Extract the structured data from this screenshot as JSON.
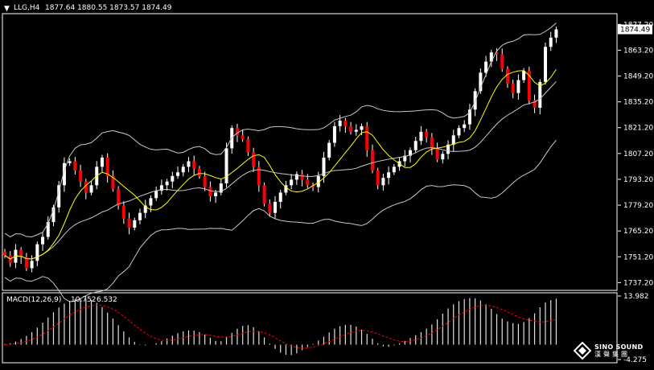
{
  "header": {
    "symbol_timeframe": "LLG,H4",
    "ohlc_values": "1877.64 1880.55 1873.57 1874.49"
  },
  "watermark": {
    "title": "SINO SOUND",
    "subtitle": "漢聲集團"
  },
  "chart_data": [
    {
      "type": "candlestick",
      "title": "LLG,H4",
      "ylim": [
        1733,
        1883
      ],
      "yticks": [
        "1877.20",
        "1863.20",
        "1849.20",
        "1835.20",
        "1821.20",
        "1807.20",
        "1793.20",
        "1779.20",
        "1765.20",
        "1751.20",
        "1737.20"
      ],
      "current_price": "1874.49",
      "colors": {
        "up": "#ffffff",
        "down": "#ff0000",
        "wick": "#ffffff",
        "ma": "#ffff00",
        "bands": "#c8c8c8",
        "axis": "#ffffff"
      },
      "overlays": [
        "moving average (yellow)",
        "Bollinger bands (grey)"
      ],
      "close": [
        1752,
        1748,
        1755,
        1751,
        1745,
        1749,
        1758,
        1762,
        1770,
        1778,
        1790,
        1802,
        1803,
        1798,
        1792,
        1786,
        1790,
        1800,
        1805,
        1795,
        1788,
        1779,
        1772,
        1767,
        1771,
        1775,
        1779,
        1783,
        1787,
        1790,
        1792,
        1795,
        1797,
        1800,
        1803,
        1799,
        1795,
        1789,
        1784,
        1786,
        1791,
        1810,
        1821,
        1817,
        1815,
        1808,
        1800,
        1790,
        1780,
        1775,
        1781,
        1786,
        1790,
        1793,
        1796,
        1793,
        1790,
        1789,
        1795,
        1805,
        1813,
        1822,
        1825,
        1822,
        1819,
        1820,
        1822,
        1809,
        1798,
        1790,
        1794,
        1797,
        1800,
        1803,
        1806,
        1809,
        1814,
        1819,
        1816,
        1810,
        1804,
        1807,
        1812,
        1817,
        1821,
        1823,
        1831,
        1841,
        1851,
        1857,
        1862,
        1861,
        1853,
        1845,
        1840,
        1847,
        1852,
        1836,
        1832,
        1846,
        1865,
        1870,
        1874.49
      ]
    },
    {
      "type": "bar",
      "title": "MACD(12,26,9)",
      "main_value": "10.752",
      "signal_value": "6.532",
      "ylim": [
        -4.275,
        13.982
      ],
      "yticks": [
        "13.982",
        "-4.275"
      ],
      "colors": {
        "histogram": "#e0e0e0",
        "signal": "#ff0000"
      },
      "values": [
        0.2,
        0.4,
        0.9,
        1.6,
        2.5,
        3.6,
        4.9,
        6.3,
        7.8,
        9.3,
        10.7,
        11.8,
        12.6,
        13.1,
        13.4,
        13.3,
        12.9,
        12.0,
        10.8,
        9.2,
        7.5,
        5.6,
        3.8,
        2.1,
        0.8,
        0.1,
        -0.2,
        0.0,
        0.4,
        1.0,
        1.8,
        2.6,
        3.3,
        3.8,
        4.1,
        4.0,
        3.6,
        2.9,
        2.0,
        1.1,
        1.0,
        2.1,
        3.4,
        4.6,
        5.4,
        5.6,
        5.0,
        3.8,
        2.1,
        0.3,
        -1.2,
        -2.3,
        -2.9,
        -3.0,
        -2.5,
        -1.6,
        -0.7,
        0.2,
        1.2,
        2.3,
        3.5,
        4.6,
        5.3,
        5.7,
        5.7,
        5.2,
        4.3,
        3.1,
        1.7,
        0.4,
        -0.5,
        -0.6,
        -0.2,
        0.4,
        1.1,
        1.9,
        2.7,
        3.6,
        4.6,
        5.8,
        7.3,
        8.9,
        10.4,
        11.6,
        12.5,
        13.1,
        13.4,
        13.3,
        12.7,
        11.6,
        10.3,
        8.8,
        7.5,
        6.7,
        6.2,
        6.0,
        6.5,
        7.6,
        9.0,
        10.752,
        12.1,
        12.8,
        13.2
      ],
      "signal": [
        0.0,
        0.1,
        0.3,
        0.6,
        1.0,
        1.5,
        2.2,
        3.0,
        4.0,
        5.1,
        6.2,
        7.4,
        8.5,
        9.4,
        10.2,
        10.8,
        11.2,
        11.4,
        11.3,
        10.9,
        10.2,
        9.3,
        8.1,
        6.9,
        5.6,
        4.4,
        3.3,
        2.4,
        1.7,
        1.3,
        1.2,
        1.3,
        1.6,
        2.0,
        2.4,
        2.7,
        2.9,
        2.9,
        2.7,
        2.4,
        2.2,
        2.2,
        2.4,
        2.8,
        3.3,
        3.7,
        3.9,
        3.8,
        3.4,
        2.8,
        2.0,
        1.1,
        0.3,
        -0.4,
        -0.8,
        -1.0,
        -0.9,
        -0.7,
        -0.3,
        0.3,
        0.9,
        1.6,
        2.3,
        3.0,
        3.5,
        3.9,
        4.1,
        4.0,
        3.6,
        3.1,
        2.5,
        1.9,
        1.4,
        1.0,
        0.9,
        1.0,
        1.4,
        1.9,
        2.6,
        3.4,
        4.3,
        5.3,
        6.4,
        7.5,
        8.5,
        9.4,
        10.2,
        10.8,
        11.2,
        11.3,
        11.1,
        10.7,
        10.1,
        9.4,
        8.7,
        8.0,
        7.4,
        7.0,
        6.8,
        6.532,
        6.6,
        6.9,
        7.3
      ]
    }
  ]
}
